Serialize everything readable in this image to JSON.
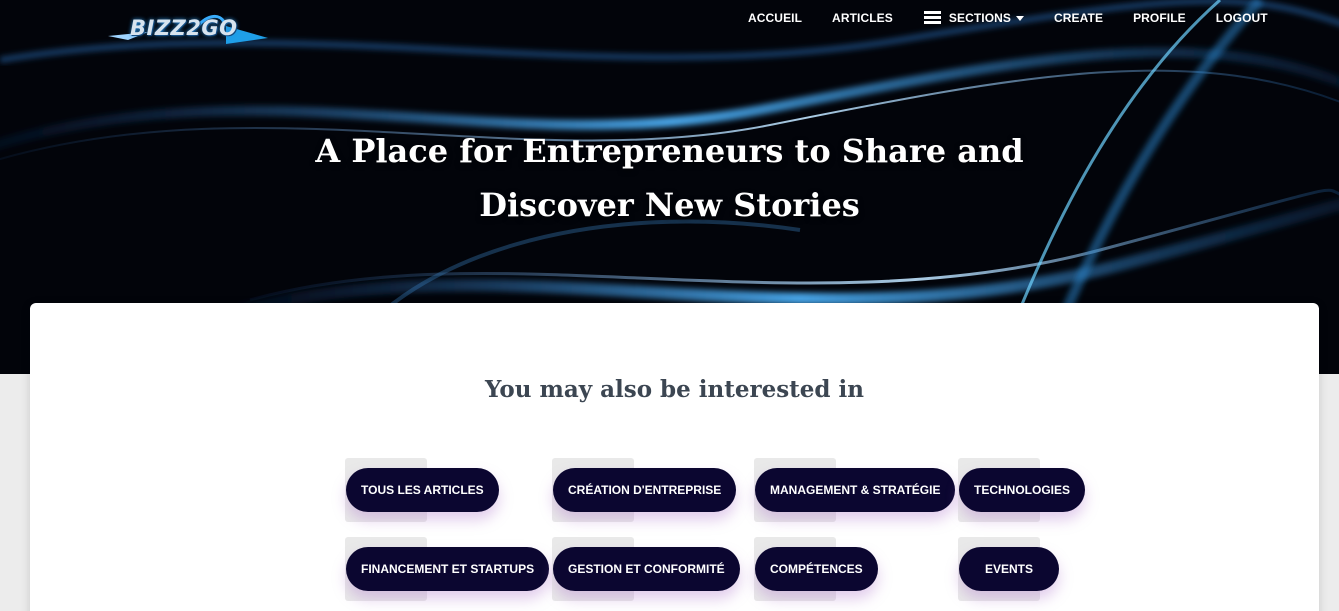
{
  "brand": {
    "logo_text": "BIZZ2GO"
  },
  "nav": {
    "accueil": "ACCUEIL",
    "articles": "ARTICLES",
    "sections": "SECTIONS",
    "create": "CREATE",
    "profile": "PROFILE",
    "logout": "LOGOUT"
  },
  "hero": {
    "line1": "A Place for Entrepreneurs to Share and",
    "line2": "Discover New Stories"
  },
  "suggestions": {
    "title": "You may also be interested in",
    "categories": [
      "TOUS LES ARTICLES",
      "CRÉATION D'ENTREPRISE",
      "MANAGEMENT & STRATÉGIE",
      "TECHNOLOGIES",
      "FINANCEMENT ET STARTUPS",
      "GESTION ET CONFORMITÉ",
      "COMPÉTENCES",
      "EVENTS"
    ]
  },
  "colors": {
    "chip_background": "#0b0630",
    "hero_background": "#02040a",
    "accent_glow": "#2a8cd6"
  },
  "icons": {
    "sections_icon": "hamburger-icon",
    "dropdown_icon": "caret-down-icon"
  }
}
